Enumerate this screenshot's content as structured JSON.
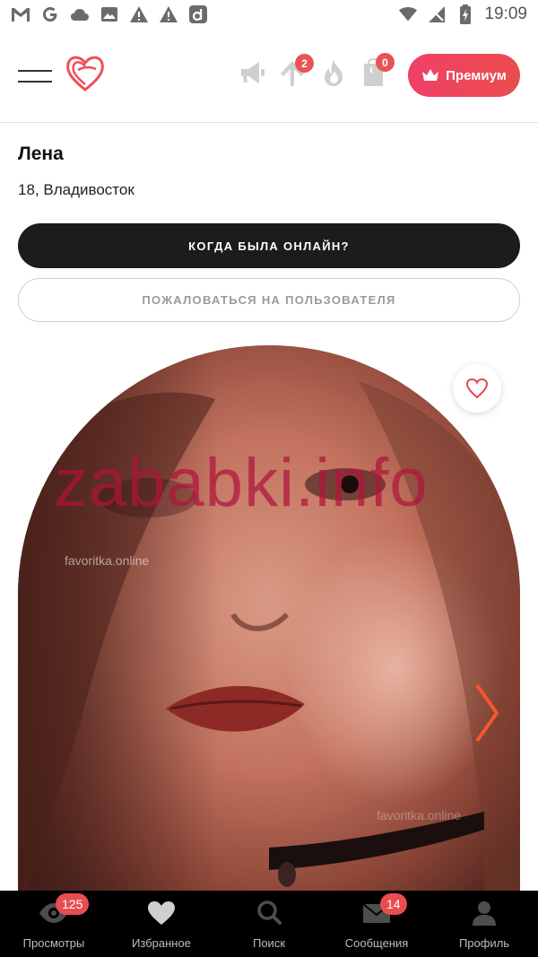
{
  "status_bar": {
    "time": "19:09",
    "left_icons": [
      "gmail-icon",
      "google-icon",
      "cloud-icon",
      "image-icon",
      "warning-icon",
      "warning-icon",
      "app-d-icon"
    ],
    "right_icons": [
      "wifi-icon",
      "no-sim-icon",
      "battery-charging-icon"
    ]
  },
  "header": {
    "premium_label": "Премиум",
    "boost_badge": "2",
    "cart_badge": "0"
  },
  "profile": {
    "name": "Лена",
    "age_city": "18, Владивосток",
    "online_button": "КОГДА БЫЛА ОНЛАЙН?",
    "report_button": "ПОЖАЛОВАТЬСЯ НА ПОЛЬЗОВАТЕЛЯ"
  },
  "photo": {
    "watermark_main": "zababki.info",
    "watermark_small_1": "favoritka.online",
    "watermark_small_2": "favoritka.online"
  },
  "bottom_nav": {
    "items": [
      {
        "label": "Просмотры",
        "icon": "eye-icon",
        "badge": "125"
      },
      {
        "label": "Избранное",
        "icon": "heart-icon",
        "badge": ""
      },
      {
        "label": "Поиск",
        "icon": "search-icon",
        "badge": ""
      },
      {
        "label": "Сообщения",
        "icon": "mail-icon",
        "badge": "14"
      },
      {
        "label": "Профиль",
        "icon": "user-icon",
        "badge": ""
      }
    ]
  },
  "colors": {
    "accent": "#e8474f",
    "dark_button": "#1c1c1c",
    "nav_background": "#000000"
  }
}
